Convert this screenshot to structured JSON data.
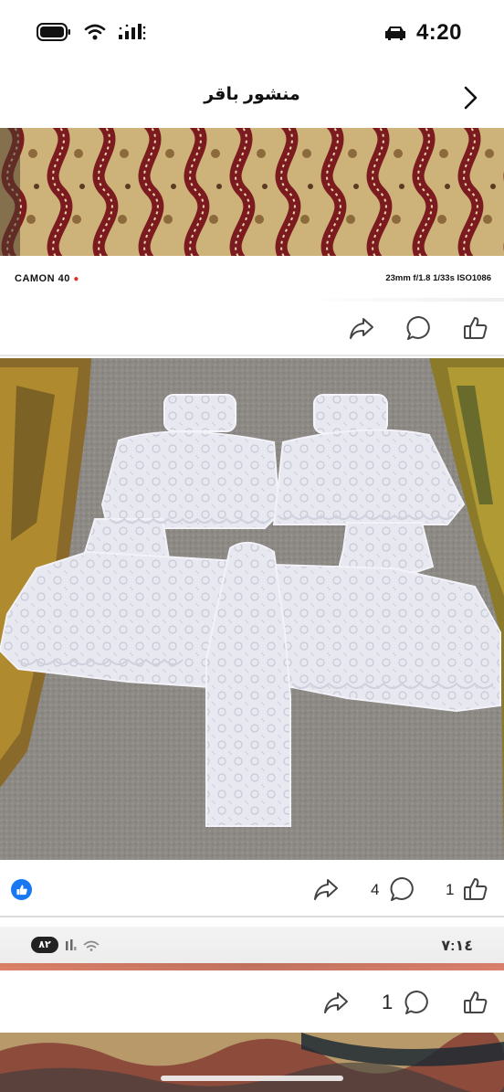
{
  "status_bar": {
    "time": "4:20"
  },
  "header": {
    "title": "منشور باقر"
  },
  "photo1": {
    "camera_model": "CAMON 40",
    "camera_info": "23mm f/1.8 1/33s ISO1086"
  },
  "post1_actions": {
    "share": "share-icon",
    "comment": "comment-icon",
    "like": "thumbs-up-icon"
  },
  "post2_actions": {
    "comment_count": "4",
    "like_count": "1",
    "reaction": "like-reaction-icon"
  },
  "nested_status": {
    "battery": "٨٢",
    "time": "٧:١٤"
  },
  "post3_actions": {
    "comment_count": "1"
  },
  "colors": {
    "like_blue": "#1877f2",
    "icon_gray": "#444444",
    "carpet_maroon": "#7c1b1f",
    "carpet_gold": "#c9a86b"
  }
}
